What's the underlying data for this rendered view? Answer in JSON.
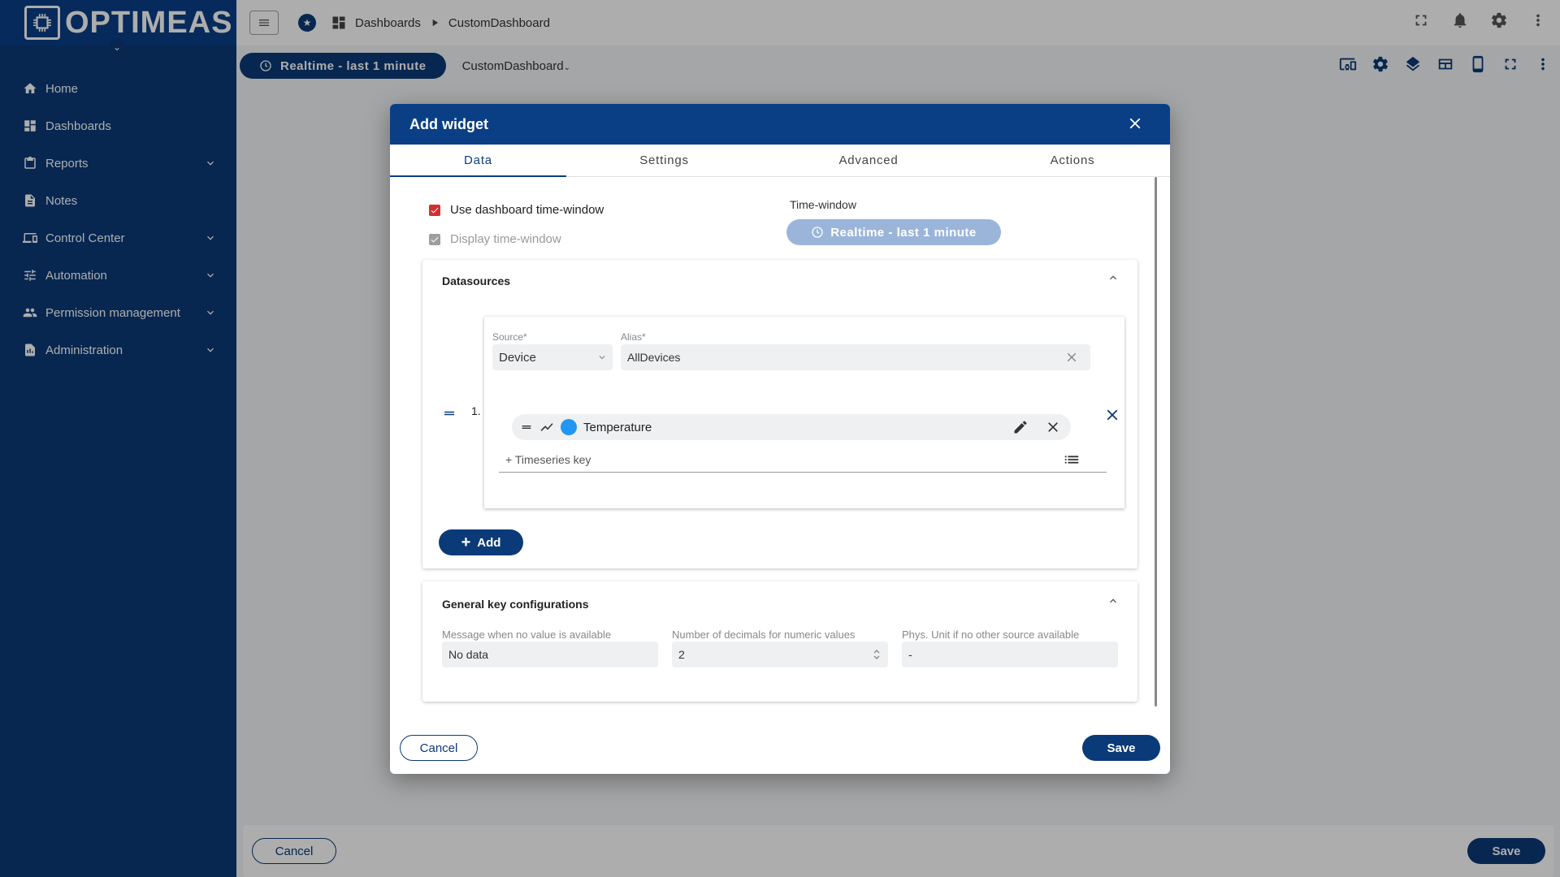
{
  "app": {
    "logo_text": "OPTIMEAS",
    "logo_mark": "▣"
  },
  "sidebar": {
    "items": [
      {
        "label": "Home",
        "icon": "home-icon",
        "expandable": false
      },
      {
        "label": "Dashboards",
        "icon": "dashboard-icon",
        "expandable": false
      },
      {
        "label": "Reports",
        "icon": "clipboard-icon",
        "expandable": true
      },
      {
        "label": "Notes",
        "icon": "document-icon",
        "expandable": false
      },
      {
        "label": "Control Center",
        "icon": "devices-icon",
        "expandable": true
      },
      {
        "label": "Automation",
        "icon": "tune-icon",
        "expandable": true
      },
      {
        "label": "Permission management",
        "icon": "people-icon",
        "expandable": true
      },
      {
        "label": "Administration",
        "icon": "admin-icon",
        "expandable": true
      }
    ]
  },
  "topbar": {
    "breadcrumb": [
      "Dashboards",
      "CustomDashboard"
    ]
  },
  "toolbar": {
    "timewindow": "Realtime - last 1 minute",
    "dashboard_select": "CustomDashboard"
  },
  "bottombar": {
    "cancel": "Cancel",
    "save": "Save"
  },
  "dialog": {
    "title": "Add widget",
    "tabs": [
      "Data",
      "Settings",
      "Advanced",
      "Actions"
    ],
    "active_tab": "Data",
    "use_dashboard_tw_label": "Use dashboard time-window",
    "display_tw_label": "Display time-window",
    "timewindow_label": "Time-window",
    "timewindow_value": "Realtime - last 1 minute",
    "datasources": {
      "title": "Datasources",
      "index": "1.",
      "source_label": "Source*",
      "source_value": "Device",
      "alias_label": "Alias*",
      "alias_value": "AllDevices",
      "key_name": "Temperature",
      "key_color": "#2196f3",
      "add_key_placeholder": "+ Timeseries key",
      "add_button": "Add"
    },
    "general": {
      "title": "General key configurations",
      "no_value_label": "Message when no value is available",
      "no_value_value": "No data",
      "decimals_label": "Number of decimals for numeric values",
      "decimals_value": "2",
      "unit_label": "Phys. Unit if no other source available",
      "unit_value": "-"
    },
    "cancel": "Cancel",
    "save": "Save"
  },
  "colors": {
    "primary": "#0b3a78",
    "checkbox": "#d32f2f"
  }
}
